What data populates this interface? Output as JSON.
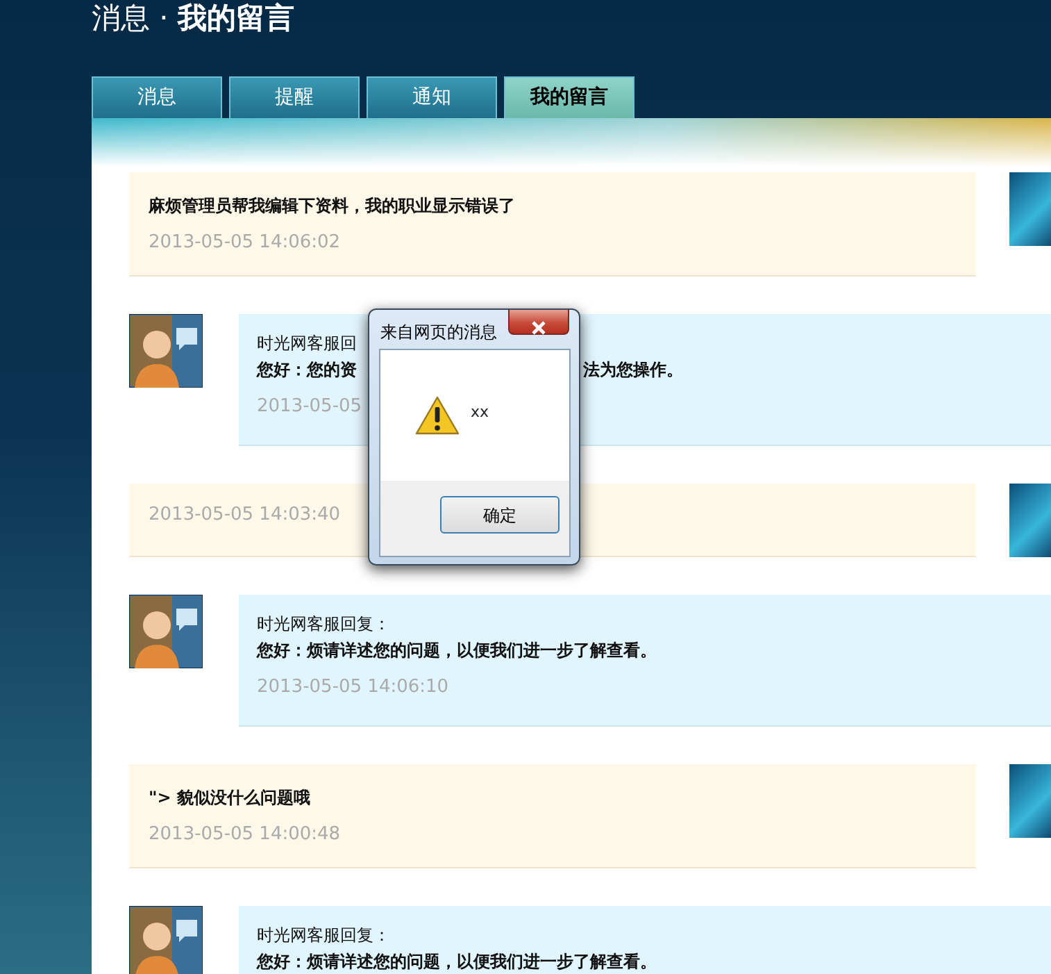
{
  "page_title": "消息 · **我的留言**",
  "tabs": [
    {
      "label": "消息",
      "selected": false
    },
    {
      "label": "提醒",
      "selected": false
    },
    {
      "label": "通知",
      "selected": false
    },
    {
      "label": "我的留言",
      "selected": true
    }
  ],
  "items": [
    {
      "kind": "message",
      "text": [
        "麻烦管理员帮我编辑下资料，我的职业显示错误了"
      ],
      "time": [
        "2013-05-05 14:06:02"
      ]
    },
    {
      "kind": "reply",
      "label": [
        "时光网客服回"
      ],
      "body": [
        "您好：您的资",
        "法为您操作。"
      ],
      "time": [
        "2013-05-05"
      ]
    },
    {
      "kind": "message",
      "time": [
        "2013-05-05 14:03:40"
      ]
    },
    {
      "kind": "reply",
      "label": [
        "时光网客服回复："
      ],
      "body": [
        "您好：烦请详述您的问题，以便我们进一步了解查看。"
      ],
      "time": [
        "2013-05-05 14:06:10"
      ]
    },
    {
      "kind": "message",
      "text": [
        "\"> 貌似没什么问题哦"
      ],
      "time": [
        "2013-05-05 14:00:48"
      ]
    },
    {
      "kind": "reply",
      "label": [
        "时光网客服回复："
      ],
      "body": [
        "您好：烦请详述您的问题，以便我们进一步了解查看。"
      ]
    }
  ],
  "dialog": {
    "title": "来自网页的消息",
    "message": "xx",
    "button": "确定"
  }
}
